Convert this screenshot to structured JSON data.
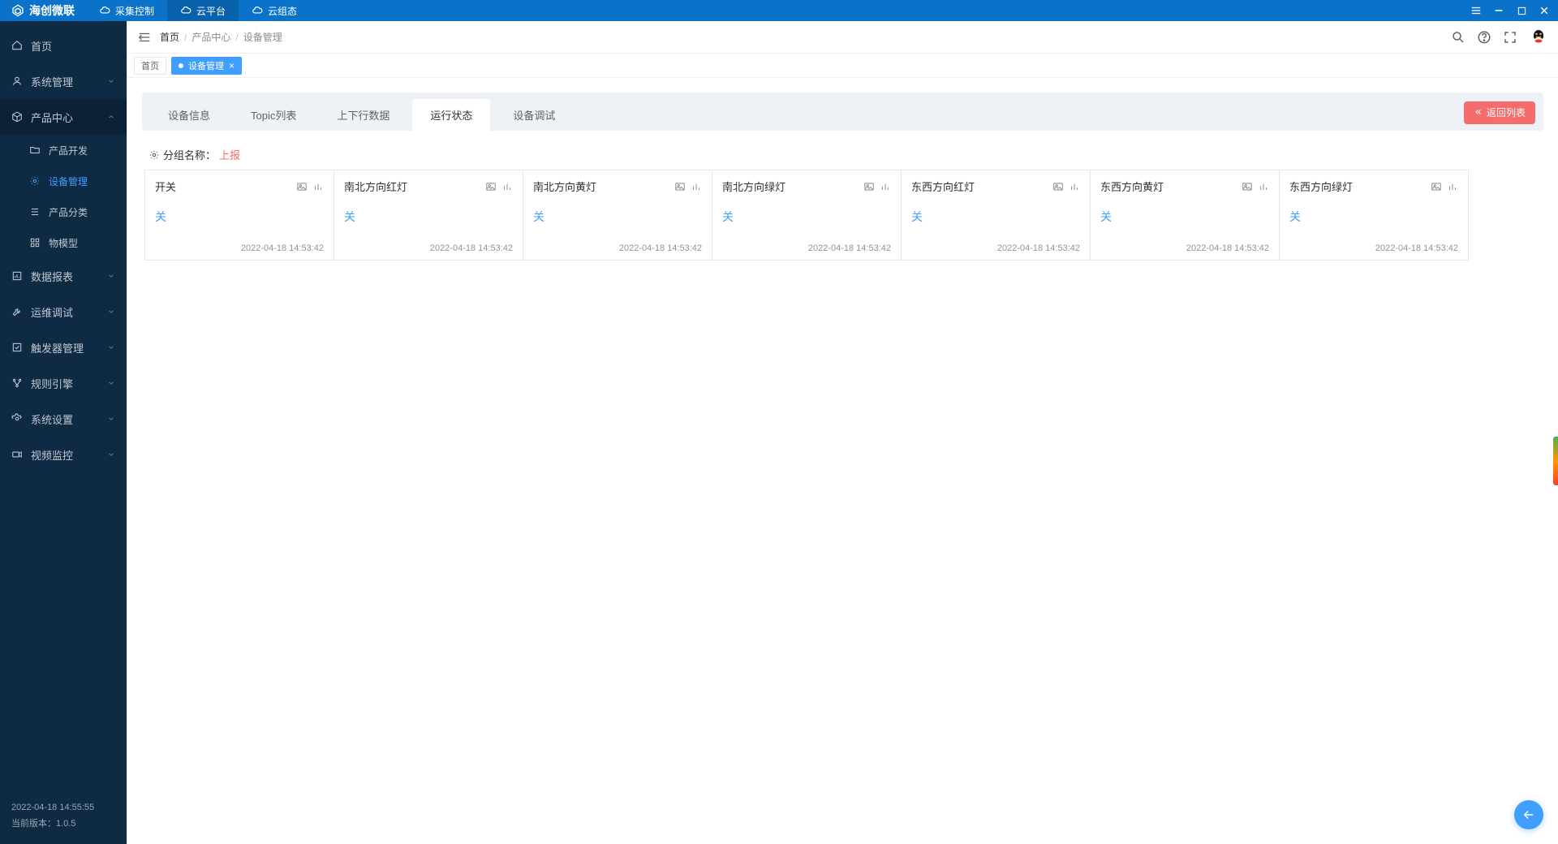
{
  "brand": "海创微联",
  "topnav": [
    {
      "label": "采集控制",
      "active": false
    },
    {
      "label": "云平台",
      "active": true
    },
    {
      "label": "云组态",
      "active": false
    }
  ],
  "sidebar": {
    "items": [
      {
        "label": "首页",
        "icon": "home",
        "expandable": false
      },
      {
        "label": "系统管理",
        "icon": "user",
        "expandable": true
      },
      {
        "label": "产品中心",
        "icon": "cube",
        "expandable": true,
        "expanded": true,
        "children": [
          {
            "label": "产品开发",
            "icon": "folder"
          },
          {
            "label": "设备管理",
            "icon": "gear",
            "active": true
          },
          {
            "label": "产品分类",
            "icon": "list"
          },
          {
            "label": "物模型",
            "icon": "grid"
          }
        ]
      },
      {
        "label": "数据报表",
        "icon": "report",
        "expandable": true
      },
      {
        "label": "运维调试",
        "icon": "wrench",
        "expandable": true
      },
      {
        "label": "触发器管理",
        "icon": "trigger",
        "expandable": true
      },
      {
        "label": "规则引擎",
        "icon": "rules",
        "expandable": true
      },
      {
        "label": "系统设置",
        "icon": "settings",
        "expandable": true
      },
      {
        "label": "视频监控",
        "icon": "camera",
        "expandable": true
      }
    ],
    "footer_time": "2022-04-18 14:55:55",
    "footer_version": "当前版本：1.0.5"
  },
  "breadcrumb": [
    "首页",
    "产品中心",
    "设备管理"
  ],
  "page_tabs": [
    {
      "label": "首页",
      "active": false
    },
    {
      "label": "设备管理",
      "active": true
    }
  ],
  "panel": {
    "tabs": [
      "设备信息",
      "Topic列表",
      "上下行数据",
      "运行状态",
      "设备调试"
    ],
    "active_tab_index": 3,
    "back_btn": "返回列表",
    "group_label": "分组名称：",
    "group_value": "上报",
    "cards": [
      {
        "title": "开关",
        "value": "关",
        "ts": "2022-04-18 14:53:42"
      },
      {
        "title": "南北方向红灯",
        "value": "关",
        "ts": "2022-04-18 14:53:42"
      },
      {
        "title": "南北方向黄灯",
        "value": "关",
        "ts": "2022-04-18 14:53:42"
      },
      {
        "title": "南北方向绿灯",
        "value": "关",
        "ts": "2022-04-18 14:53:42"
      },
      {
        "title": "东西方向红灯",
        "value": "关",
        "ts": "2022-04-18 14:53:42"
      },
      {
        "title": "东西方向黄灯",
        "value": "关",
        "ts": "2022-04-18 14:53:42"
      },
      {
        "title": "东西方向绿灯",
        "value": "关",
        "ts": "2022-04-18 14:53:42"
      }
    ]
  }
}
